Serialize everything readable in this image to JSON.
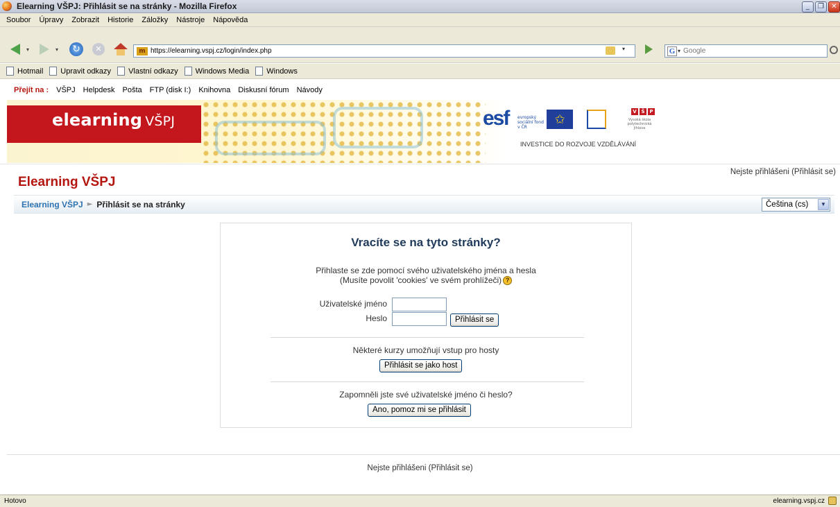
{
  "window": {
    "title": "Elearning VŠPJ: Přihlásit se na stránky - Mozilla Firefox"
  },
  "menu": {
    "items": [
      "Soubor",
      "Úpravy",
      "Zobrazit",
      "Historie",
      "Záložky",
      "Nástroje",
      "Nápověda"
    ]
  },
  "navigation": {
    "favicon_text": "m",
    "url": "https://elearning.vspj.cz/login/index.php",
    "search_placeholder": "Google",
    "search_engine_icon": "G"
  },
  "bookmarks": {
    "items": [
      "Hotmail",
      "Upravit odkazy",
      "Vlastní odkazy",
      "Windows Media",
      "Windows"
    ]
  },
  "quicklinks": {
    "label": "Přejít na :",
    "items": [
      "VŠPJ",
      "Helpdesk",
      "Pošta",
      "FTP (disk I:)",
      "Knihovna",
      "Diskusní fórum",
      "Návody"
    ]
  },
  "banner": {
    "logo_main": "elearning",
    "logo_suffix": "VŠPJ",
    "eu_caption": "INVESTICE DO ROZVOJE VZDĚLÁVÁNÍ",
    "esf_text": "esf",
    "esf_sub": "evropský sociální fond v ČR",
    "school_letters": [
      "V",
      "Š",
      "P"
    ],
    "school_sub": "Vysoká škola polytechnická Jihlava"
  },
  "header": {
    "site_title": "Elearning VŠPJ",
    "login_info_prefix": "Nejste přihlášeni (",
    "login_link": "Přihlásit se",
    "login_info_suffix": ")"
  },
  "breadcrumb": {
    "home": "Elearning VŠPJ",
    "separator": "►",
    "current": "Přihlásit se na stránky",
    "language_selected": "Čeština (cs)"
  },
  "login": {
    "heading": "Vracíte se na tyto stránky?",
    "desc_line1": "Přihlaste se zde pomocí svého uživatelského jména a hesla",
    "desc_line2": "(Musíte povolit 'cookies' ve svém prohlížeči)",
    "username_label": "Uživatelské jméno",
    "username_value": "",
    "password_label": "Heslo",
    "password_value": "",
    "submit_label": "Přihlásit se",
    "guest_text": "Některé kurzy umožňují vstup pro hosty",
    "guest_button": "Přihlásit se jako host",
    "forgot_text": "Zapomněli jste své uživatelské jméno či heslo?",
    "forgot_button": "Ano, pomoz mi se přihlásit"
  },
  "footer": {
    "login_info_prefix": "Nejste přihlášeni (",
    "login_link": "Přihlásit se",
    "login_info_suffix": ")"
  },
  "status": {
    "text": "Hotovo",
    "domain": "elearning.vspj.cz"
  },
  "colors": {
    "brand_red": "#c4171d",
    "title_red": "#b5150f",
    "link_blue": "#2f73b0"
  }
}
